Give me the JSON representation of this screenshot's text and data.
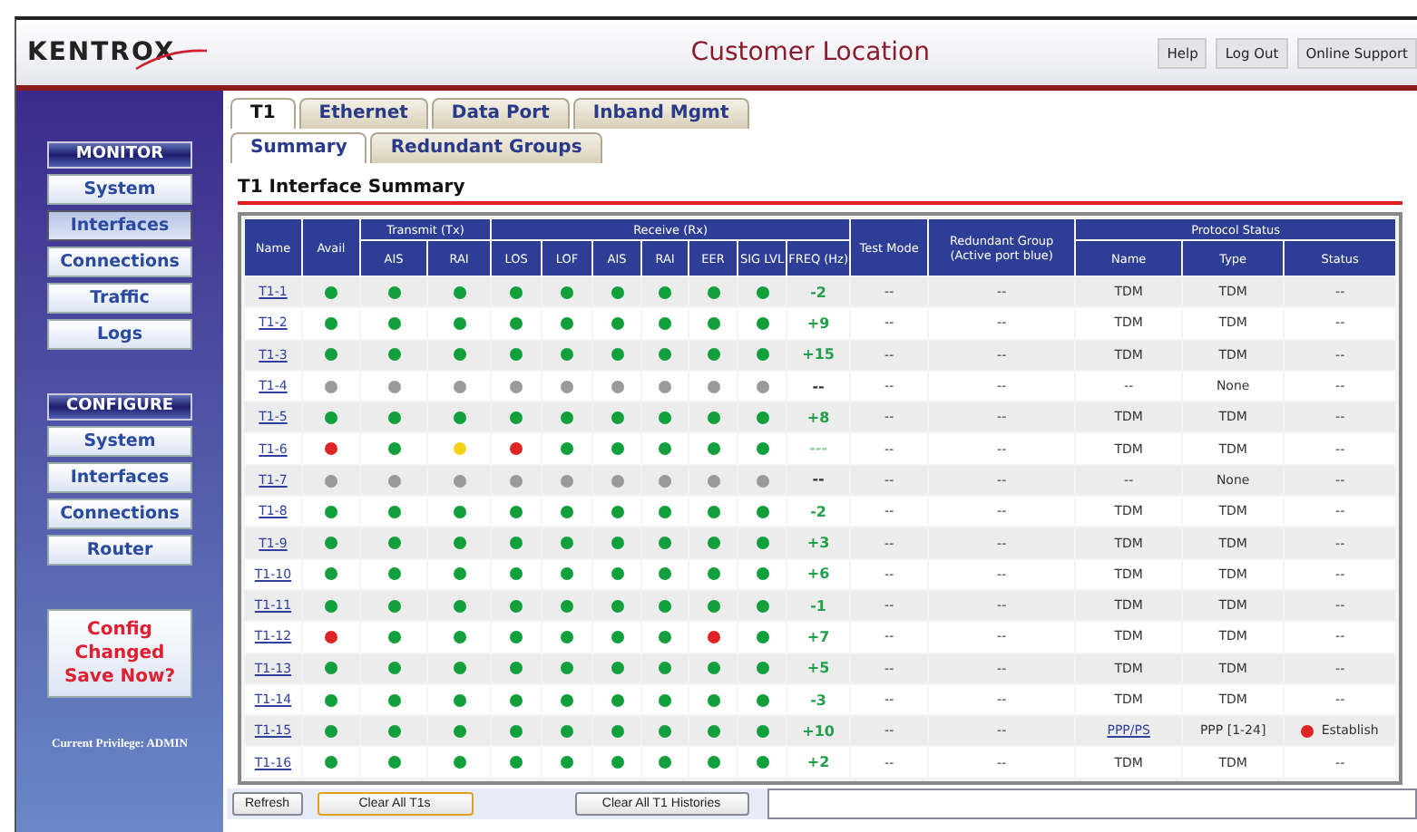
{
  "header": {
    "logo": "KENTROX",
    "title": "Customer Location",
    "links": [
      "Help",
      "Log Out",
      "Online Support"
    ]
  },
  "sidebar": {
    "sections": [
      {
        "heading": "MONITOR",
        "items": [
          {
            "label": "System",
            "selected": false
          },
          {
            "label": "Interfaces",
            "selected": true
          },
          {
            "label": "Connections",
            "selected": false
          },
          {
            "label": "Traffic",
            "selected": false
          },
          {
            "label": "Logs",
            "selected": false
          }
        ]
      },
      {
        "heading": "CONFIGURE",
        "items": [
          {
            "label": "System",
            "selected": false
          },
          {
            "label": "Interfaces",
            "selected": false
          },
          {
            "label": "Connections",
            "selected": false
          },
          {
            "label": "Router",
            "selected": false
          }
        ]
      }
    ],
    "alert": "Config Changed Save Now?",
    "privilege": "Current Privilege: ADMIN"
  },
  "tabs": [
    {
      "label": "T1",
      "selected": true
    },
    {
      "label": "Ethernet",
      "selected": false
    },
    {
      "label": "Data Port",
      "selected": false
    },
    {
      "label": "Inband Mgmt",
      "selected": false
    }
  ],
  "subtabs": [
    {
      "label": "Summary",
      "selected": true
    },
    {
      "label": "Redundant Groups",
      "selected": false
    }
  ],
  "section_title": "T1 Interface Summary",
  "table": {
    "column_groups": [
      {
        "label": "Name"
      },
      {
        "label": "Avail"
      },
      {
        "label": "Transmit (Tx)",
        "columns": [
          "AIS",
          "RAI"
        ]
      },
      {
        "label": "Receive (Rx)",
        "columns": [
          "LOS",
          "LOF",
          "AIS",
          "RAI",
          "EER",
          "SIG LVL",
          "FREQ (Hz)"
        ]
      },
      {
        "label": "Test Mode"
      },
      {
        "label": "Redundant Group (Active port blue)"
      },
      {
        "label": "Protocol Status",
        "columns": [
          "Name",
          "Type",
          "Status"
        ]
      }
    ],
    "rows": [
      {
        "name": "T1-1",
        "dots": [
          {
            "color": "#11a03c"
          },
          {
            "color": "#11a03c"
          },
          {
            "color": "#11a03c"
          },
          {
            "color": "#11a03c"
          },
          {
            "color": "#11a03c"
          },
          {
            "color": "#11a03c"
          },
          {
            "color": "#11a03c"
          },
          {
            "color": "#11a03c"
          },
          {
            "color": "#11a03c"
          }
        ],
        "freq": {
          "text": "-2",
          "color": "#23a04a"
        },
        "test_mode": "--",
        "redundant_group": "--",
        "protocol_name": "TDM",
        "protocol_link": false,
        "protocol_type": "TDM",
        "status": {
          "text": "--"
        }
      },
      {
        "name": "T1-2",
        "dots": [
          {
            "color": "#11a03c"
          },
          {
            "color": "#11a03c"
          },
          {
            "color": "#11a03c"
          },
          {
            "color": "#11a03c"
          },
          {
            "color": "#11a03c"
          },
          {
            "color": "#11a03c"
          },
          {
            "color": "#11a03c"
          },
          {
            "color": "#11a03c"
          },
          {
            "color": "#11a03c"
          }
        ],
        "freq": {
          "text": "+9",
          "color": "#23a04a"
        },
        "test_mode": "--",
        "redundant_group": "--",
        "protocol_name": "TDM",
        "protocol_link": false,
        "protocol_type": "TDM",
        "status": {
          "text": "--"
        }
      },
      {
        "name": "T1-3",
        "dots": [
          {
            "color": "#11a03c"
          },
          {
            "color": "#11a03c"
          },
          {
            "color": "#11a03c"
          },
          {
            "color": "#11a03c"
          },
          {
            "color": "#11a03c"
          },
          {
            "color": "#11a03c"
          },
          {
            "color": "#11a03c"
          },
          {
            "color": "#11a03c"
          },
          {
            "color": "#11a03c"
          }
        ],
        "freq": {
          "text": "+15",
          "color": "#23a04a"
        },
        "test_mode": "--",
        "redundant_group": "--",
        "protocol_name": "TDM",
        "protocol_link": false,
        "protocol_type": "TDM",
        "status": {
          "text": "--"
        }
      },
      {
        "name": "T1-4",
        "dots": [
          {
            "color": "#9a9a9a"
          },
          {
            "color": "#9a9a9a"
          },
          {
            "color": "#9a9a9a"
          },
          {
            "color": "#9a9a9a"
          },
          {
            "color": "#9a9a9a"
          },
          {
            "color": "#9a9a9a"
          },
          {
            "color": "#9a9a9a"
          },
          {
            "color": "#9a9a9a"
          },
          {
            "color": "#9a9a9a"
          }
        ],
        "freq": {
          "text": "--",
          "color": "#333333"
        },
        "test_mode": "--",
        "redundant_group": "--",
        "protocol_name": "--",
        "protocol_link": false,
        "protocol_type": "None",
        "status": {
          "text": "--"
        }
      },
      {
        "name": "T1-5",
        "dots": [
          {
            "color": "#11a03c"
          },
          {
            "color": "#11a03c"
          },
          {
            "color": "#11a03c"
          },
          {
            "color": "#11a03c"
          },
          {
            "color": "#11a03c"
          },
          {
            "color": "#11a03c"
          },
          {
            "color": "#11a03c"
          },
          {
            "color": "#11a03c"
          },
          {
            "color": "#11a03c"
          }
        ],
        "freq": {
          "text": "+8",
          "color": "#23a04a"
        },
        "test_mode": "--",
        "redundant_group": "--",
        "protocol_name": "TDM",
        "protocol_link": false,
        "protocol_type": "TDM",
        "status": {
          "text": "--"
        }
      },
      {
        "name": "T1-6",
        "dots": [
          {
            "color": "#e02424"
          },
          {
            "color": "#11a03c"
          },
          {
            "color": "#f2d21a"
          },
          {
            "color": "#e02424"
          },
          {
            "color": "#11a03c"
          },
          {
            "color": "#11a03c"
          },
          {
            "color": "#11a03c"
          },
          {
            "color": "#11a03c"
          },
          {
            "color": "#11a03c"
          }
        ],
        "freq": {
          "text": "---",
          "color": "#8fd0a0"
        },
        "test_mode": "--",
        "redundant_group": "--",
        "protocol_name": "TDM",
        "protocol_link": false,
        "protocol_type": "TDM",
        "status": {
          "text": "--"
        }
      },
      {
        "name": "T1-7",
        "dots": [
          {
            "color": "#9a9a9a"
          },
          {
            "color": "#9a9a9a"
          },
          {
            "color": "#9a9a9a"
          },
          {
            "color": "#9a9a9a"
          },
          {
            "color": "#9a9a9a"
          },
          {
            "color": "#9a9a9a"
          },
          {
            "color": "#9a9a9a"
          },
          {
            "color": "#9a9a9a"
          },
          {
            "color": "#9a9a9a"
          }
        ],
        "freq": {
          "text": "--",
          "color": "#333333"
        },
        "test_mode": "--",
        "redundant_group": "--",
        "protocol_name": "--",
        "protocol_link": false,
        "protocol_type": "None",
        "status": {
          "text": "--"
        }
      },
      {
        "name": "T1-8",
        "dots": [
          {
            "color": "#11a03c"
          },
          {
            "color": "#11a03c"
          },
          {
            "color": "#11a03c"
          },
          {
            "color": "#11a03c"
          },
          {
            "color": "#11a03c"
          },
          {
            "color": "#11a03c"
          },
          {
            "color": "#11a03c"
          },
          {
            "color": "#11a03c"
          },
          {
            "color": "#11a03c"
          }
        ],
        "freq": {
          "text": "-2",
          "color": "#23a04a"
        },
        "test_mode": "--",
        "redundant_group": "--",
        "protocol_name": "TDM",
        "protocol_link": false,
        "protocol_type": "TDM",
        "status": {
          "text": "--"
        }
      },
      {
        "name": "T1-9",
        "dots": [
          {
            "color": "#11a03c"
          },
          {
            "color": "#11a03c"
          },
          {
            "color": "#11a03c"
          },
          {
            "color": "#11a03c"
          },
          {
            "color": "#11a03c"
          },
          {
            "color": "#11a03c"
          },
          {
            "color": "#11a03c"
          },
          {
            "color": "#11a03c"
          },
          {
            "color": "#11a03c"
          }
        ],
        "freq": {
          "text": "+3",
          "color": "#23a04a"
        },
        "test_mode": "--",
        "redundant_group": "--",
        "protocol_name": "TDM",
        "protocol_link": false,
        "protocol_type": "TDM",
        "status": {
          "text": "--"
        }
      },
      {
        "name": "T1-10",
        "dots": [
          {
            "color": "#11a03c"
          },
          {
            "color": "#11a03c"
          },
          {
            "color": "#11a03c"
          },
          {
            "color": "#11a03c"
          },
          {
            "color": "#11a03c"
          },
          {
            "color": "#11a03c"
          },
          {
            "color": "#11a03c"
          },
          {
            "color": "#11a03c"
          },
          {
            "color": "#11a03c"
          }
        ],
        "freq": {
          "text": "+6",
          "color": "#23a04a"
        },
        "test_mode": "--",
        "redundant_group": "--",
        "protocol_name": "TDM",
        "protocol_link": false,
        "protocol_type": "TDM",
        "status": {
          "text": "--"
        }
      },
      {
        "name": "T1-11",
        "dots": [
          {
            "color": "#11a03c"
          },
          {
            "color": "#11a03c"
          },
          {
            "color": "#11a03c"
          },
          {
            "color": "#11a03c"
          },
          {
            "color": "#11a03c"
          },
          {
            "color": "#11a03c"
          },
          {
            "color": "#11a03c"
          },
          {
            "color": "#11a03c"
          },
          {
            "color": "#11a03c"
          }
        ],
        "freq": {
          "text": "-1",
          "color": "#23a04a"
        },
        "test_mode": "--",
        "redundant_group": "--",
        "protocol_name": "TDM",
        "protocol_link": false,
        "protocol_type": "TDM",
        "status": {
          "text": "--"
        }
      },
      {
        "name": "T1-12",
        "dots": [
          {
            "color": "#e02424"
          },
          {
            "color": "#11a03c"
          },
          {
            "color": "#11a03c"
          },
          {
            "color": "#11a03c"
          },
          {
            "color": "#11a03c"
          },
          {
            "color": "#11a03c"
          },
          {
            "color": "#11a03c"
          },
          {
            "color": "#e02424"
          },
          {
            "color": "#11a03c"
          }
        ],
        "freq": {
          "text": "+7",
          "color": "#23a04a"
        },
        "test_mode": "--",
        "redundant_group": "--",
        "protocol_name": "TDM",
        "protocol_link": false,
        "protocol_type": "TDM",
        "status": {
          "text": "--"
        }
      },
      {
        "name": "T1-13",
        "dots": [
          {
            "color": "#11a03c"
          },
          {
            "color": "#11a03c"
          },
          {
            "color": "#11a03c"
          },
          {
            "color": "#11a03c"
          },
          {
            "color": "#11a03c"
          },
          {
            "color": "#11a03c"
          },
          {
            "color": "#11a03c"
          },
          {
            "color": "#11a03c"
          },
          {
            "color": "#11a03c"
          }
        ],
        "freq": {
          "text": "+5",
          "color": "#23a04a"
        },
        "test_mode": "--",
        "redundant_group": "--",
        "protocol_name": "TDM",
        "protocol_link": false,
        "protocol_type": "TDM",
        "status": {
          "text": "--"
        }
      },
      {
        "name": "T1-14",
        "dots": [
          {
            "color": "#11a03c"
          },
          {
            "color": "#11a03c"
          },
          {
            "color": "#11a03c"
          },
          {
            "color": "#11a03c"
          },
          {
            "color": "#11a03c"
          },
          {
            "color": "#11a03c"
          },
          {
            "color": "#11a03c"
          },
          {
            "color": "#11a03c"
          },
          {
            "color": "#11a03c"
          }
        ],
        "freq": {
          "text": "-3",
          "color": "#23a04a"
        },
        "test_mode": "--",
        "redundant_group": "--",
        "protocol_name": "TDM",
        "protocol_link": false,
        "protocol_type": "TDM",
        "status": {
          "text": "--"
        }
      },
      {
        "name": "T1-15",
        "dots": [
          {
            "color": "#11a03c"
          },
          {
            "color": "#11a03c"
          },
          {
            "color": "#11a03c"
          },
          {
            "color": "#11a03c"
          },
          {
            "color": "#11a03c"
          },
          {
            "color": "#11a03c"
          },
          {
            "color": "#11a03c"
          },
          {
            "color": "#11a03c"
          },
          {
            "color": "#11a03c"
          }
        ],
        "freq": {
          "text": "+10",
          "color": "#23a04a"
        },
        "test_mode": "--",
        "redundant_group": "--",
        "protocol_name": "PPP/PS",
        "protocol_link": true,
        "protocol_type": "PPP [1-24]",
        "status": {
          "text": "Establish",
          "color": "#e02424"
        }
      },
      {
        "name": "T1-16",
        "dots": [
          {
            "color": "#11a03c"
          },
          {
            "color": "#11a03c"
          },
          {
            "color": "#11a03c"
          },
          {
            "color": "#11a03c"
          },
          {
            "color": "#11a03c"
          },
          {
            "color": "#11a03c"
          },
          {
            "color": "#11a03c"
          },
          {
            "color": "#11a03c"
          },
          {
            "color": "#11a03c"
          }
        ],
        "freq": {
          "text": "+2",
          "color": "#23a04a"
        },
        "test_mode": "--",
        "redundant_group": "--",
        "protocol_name": "TDM",
        "protocol_link": false,
        "protocol_type": "TDM",
        "status": {
          "text": "--"
        }
      }
    ]
  },
  "buttons": [
    {
      "label": "Refresh",
      "highlighted": false
    },
    {
      "label": "Clear All T1s",
      "highlighted": true
    },
    {
      "label": "Clear All T1 Histories",
      "highlighted": false
    }
  ]
}
